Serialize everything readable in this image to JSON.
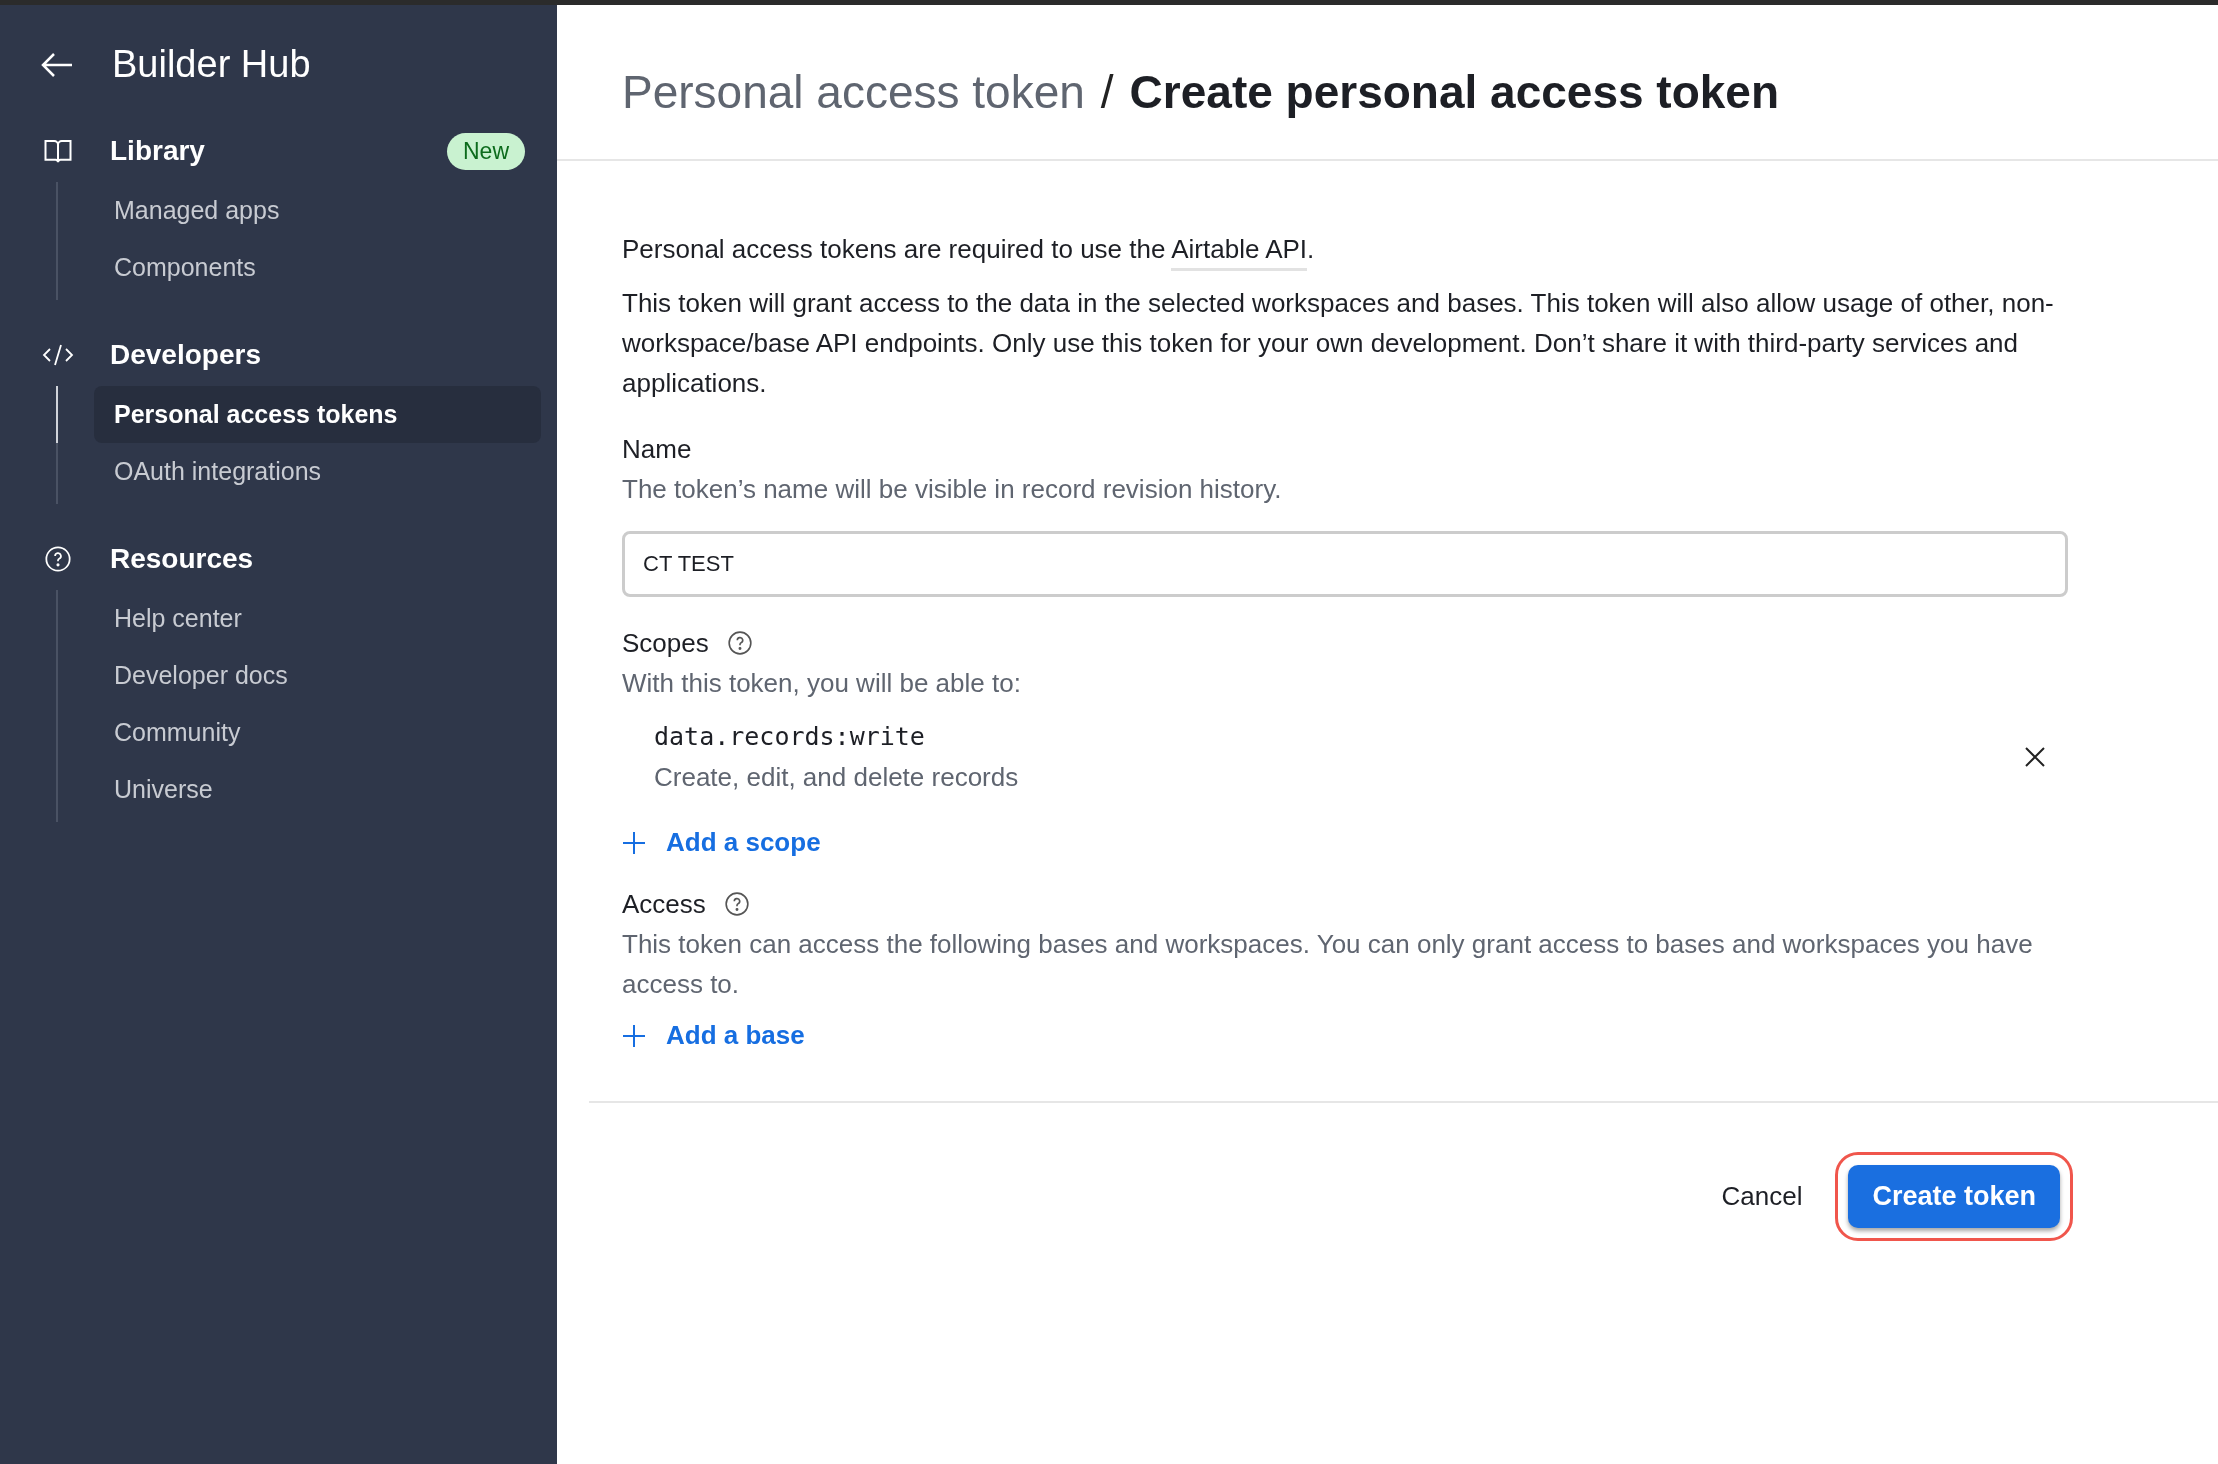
{
  "sidebar": {
    "title": "Builder Hub",
    "sections": [
      {
        "kind": "library",
        "label": "Library",
        "badge": "New",
        "items": [
          {
            "label": "Managed apps",
            "selected": false
          },
          {
            "label": "Components",
            "selected": false
          }
        ]
      },
      {
        "kind": "code",
        "label": "Developers",
        "items": [
          {
            "label": "Personal access tokens",
            "selected": true
          },
          {
            "label": "OAuth integrations",
            "selected": false
          }
        ]
      },
      {
        "kind": "help",
        "label": "Resources",
        "items": [
          {
            "label": "Help center",
            "selected": false
          },
          {
            "label": "Developer docs",
            "selected": false
          },
          {
            "label": "Community",
            "selected": false
          },
          {
            "label": "Universe",
            "selected": false
          }
        ]
      }
    ]
  },
  "header": {
    "breadcrumb": "Personal access token",
    "separator": "/",
    "title": "Create personal access token"
  },
  "intro": {
    "text": "Personal access tokens are required to use the",
    "link": "Airtable API",
    "end": "."
  },
  "description": "This token will grant access to the data in the selected workspaces and bases. This token will also allow usage of other, non-workspace/base API endpoints. Only use this token for your own development. Don’t share it with third-party services and applications.",
  "name_field": {
    "label": "Name",
    "hint": "The token’s name will be visible in record revision history.",
    "value": "CT TEST"
  },
  "scopes": {
    "label": "Scopes",
    "hint": "With this token, you will be able to:",
    "items": [
      {
        "name": "data.records:write",
        "description": "Create, edit, and delete records"
      }
    ],
    "add": "Add a scope"
  },
  "access": {
    "label": "Access",
    "hint": "This token can access the following bases and workspaces. You can only grant access to bases and workspaces you have access to.",
    "add": "Add a base"
  },
  "footer": {
    "cancel": "Cancel",
    "submit": {
      "label": "Create token",
      "highlighted": true
    }
  }
}
